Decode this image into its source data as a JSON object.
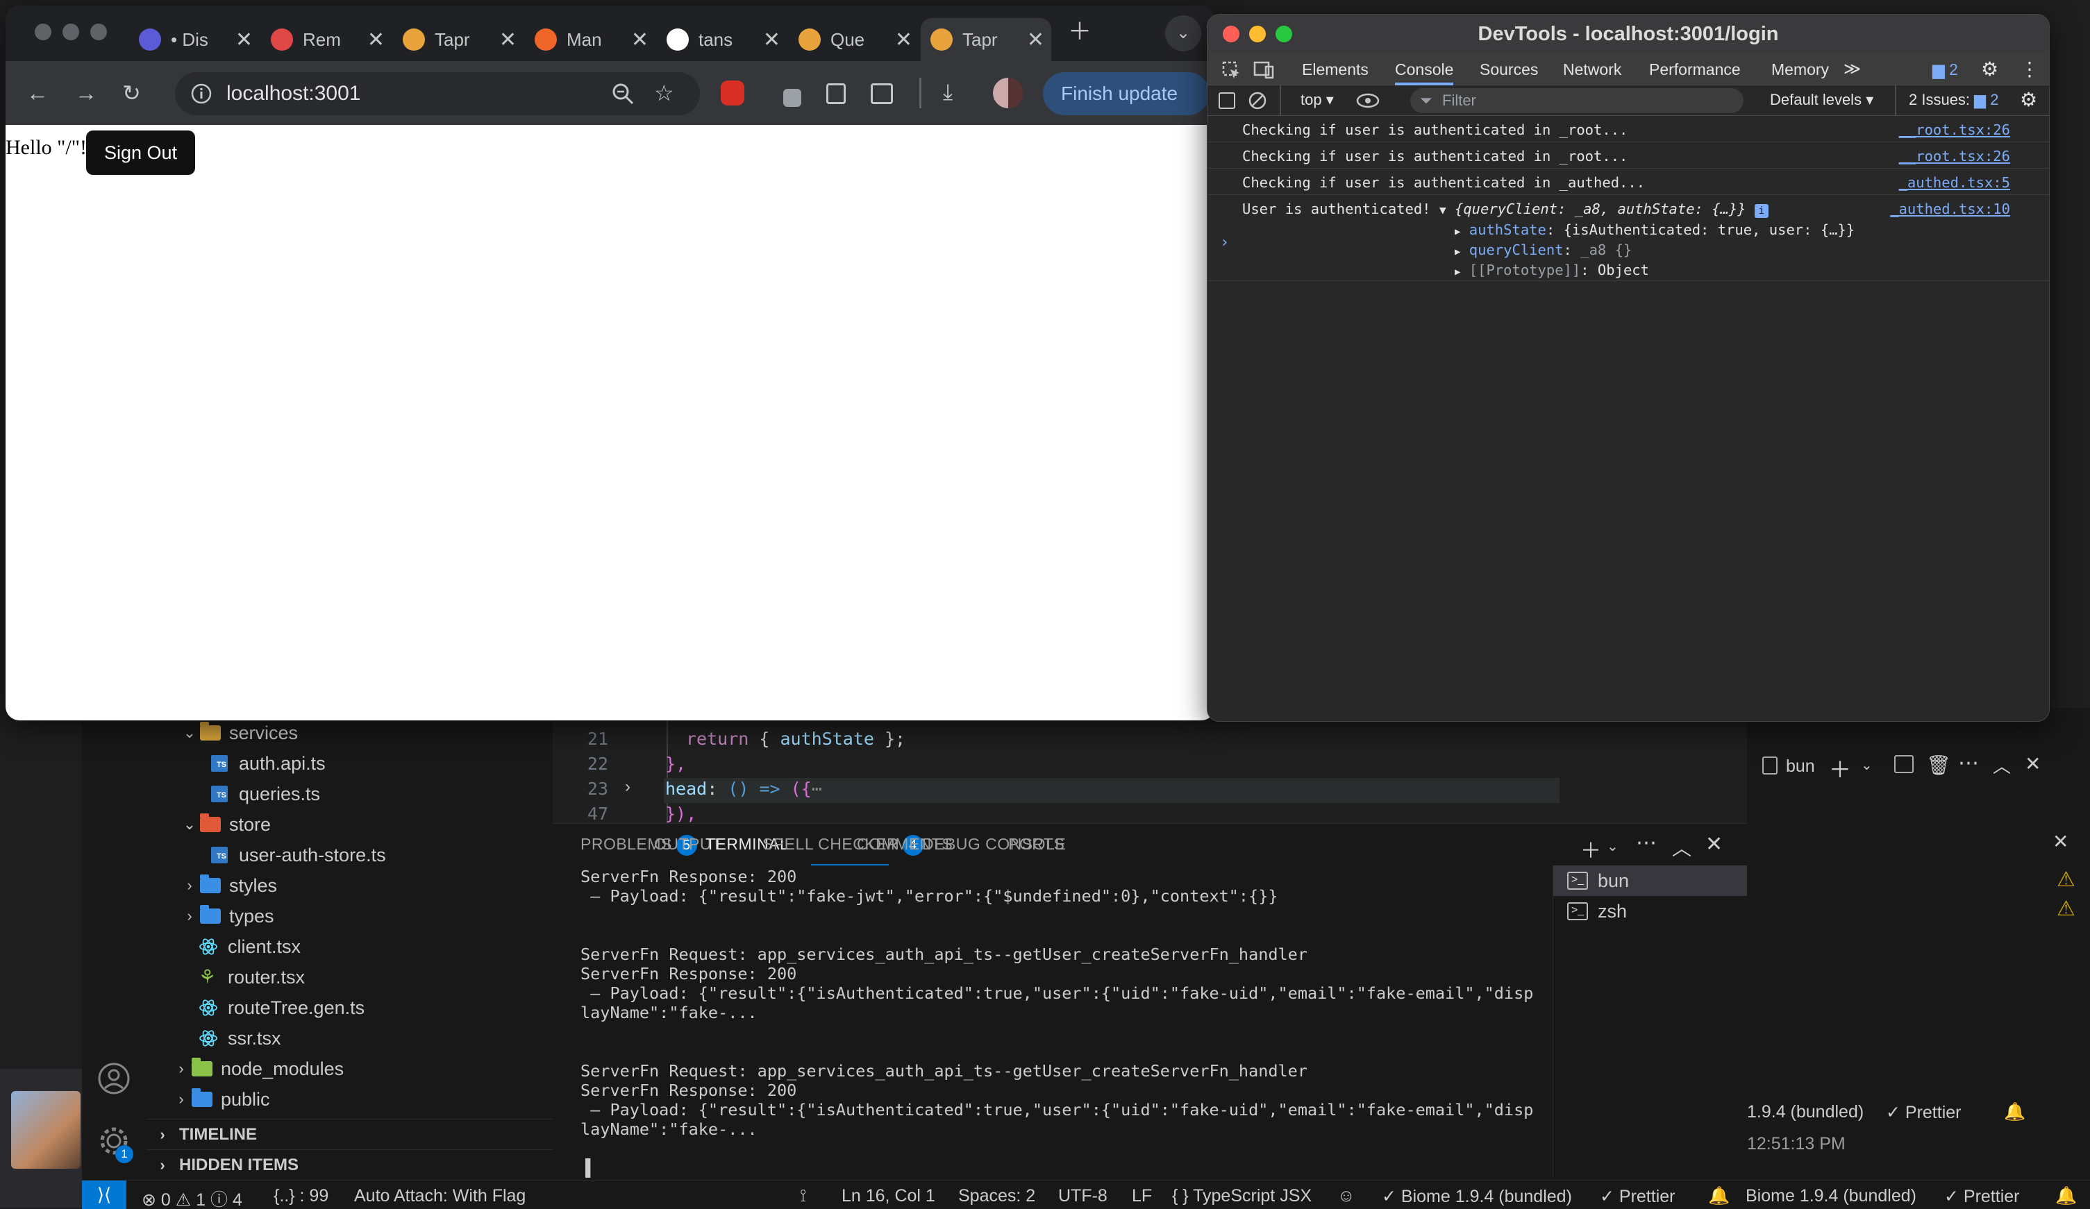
{
  "vscode": {
    "explorer": {
      "items": [
        {
          "label": "services",
          "kind": "folder",
          "open": true
        },
        {
          "label": "auth.api.ts",
          "kind": "ts"
        },
        {
          "label": "queries.ts",
          "kind": "ts"
        },
        {
          "label": "store",
          "kind": "folder",
          "open": true
        },
        {
          "label": "user-auth-store.ts",
          "kind": "ts"
        },
        {
          "label": "styles",
          "kind": "folder",
          "open": false
        },
        {
          "label": "types",
          "kind": "folder",
          "open": false
        },
        {
          "label": "client.tsx",
          "kind": "react"
        },
        {
          "label": "router.tsx",
          "kind": "router"
        },
        {
          "label": "routeTree.gen.ts",
          "kind": "react"
        },
        {
          "label": "ssr.tsx",
          "kind": "react"
        },
        {
          "label": "node_modules",
          "kind": "folder",
          "open": false
        },
        {
          "label": "public",
          "kind": "folder",
          "open": false
        }
      ],
      "sections": [
        "TIMELINE",
        "HIDDEN ITEMS"
      ]
    },
    "editor": {
      "lines": [
        {
          "num": "21",
          "code": "return { authState };"
        },
        {
          "num": "22",
          "code": "},"
        },
        {
          "num": "23",
          "code": "head: () => ({⋯"
        },
        {
          "num": "47",
          "code": "}),"
        }
      ]
    },
    "panel": {
      "tabs": [
        {
          "label": "PROBLEMS",
          "badge": "5"
        },
        {
          "label": "OUTPUT",
          "badge": ""
        },
        {
          "label": "TERMINAL",
          "badge": ""
        },
        {
          "label": "SPELL CHECKER",
          "badge": "4"
        },
        {
          "label": "COMMENTS",
          "badge": ""
        },
        {
          "label": "DEBUG CONSOLE",
          "badge": ""
        },
        {
          "label": "PORTS",
          "badge": ""
        }
      ],
      "terminal_lines": [
        "ServerFn Response: 200",
        " – Payload: {\"result\":\"fake-jwt\",\"error\":{\"$undefined\":0},\"context\":{}}",
        "",
        "",
        "ServerFn Request: app_services_auth_api_ts--getUser_createServerFn_handler",
        "ServerFn Response: 200",
        " – Payload: {\"result\":{\"isAuthenticated\":true,\"user\":{\"uid\":\"fake-uid\",\"email\":\"fake-email\",\"disp",
        "layName\":\"fake-...",
        "",
        "",
        "ServerFn Request: app_services_auth_api_ts--getUser_createServerFn_handler",
        "ServerFn Response: 200",
        " – Payload: {\"result\":{\"isAuthenticated\":true,\"user\":{\"uid\":\"fake-uid\",\"email\":\"fake-email\",\"disp",
        "layName\":\"fake-...",
        "",
        "▐"
      ],
      "terminals": [
        "bun",
        "zsh"
      ],
      "term_header": "bun"
    },
    "right_pane": {
      "biome": "1.9.4 (bundled)",
      "prettier": "Prettier",
      "time": "12:51:13 PM"
    },
    "status": {
      "errors": "0",
      "warnings": "1",
      "infos": "4",
      "json": "{..} : 99",
      "auto_attach": "Auto Attach: With Flag",
      "position": "Ln 16, Col 1",
      "spaces": "Spaces: 2",
      "encoding": "UTF-8",
      "eol": "LF",
      "language": "TypeScript JSX",
      "biome": "Biome 1.9.4 (bundled)",
      "prettier": "Prettier",
      "biome2": "Biome 1.9.4 (bundled)",
      "prettier2": "Prettier",
      "settings_badge": "1"
    }
  },
  "chrome": {
    "tabs": [
      {
        "label": "• Dis",
        "color": "#5b5bd6"
      },
      {
        "label": "Rem",
        "color": "#e04848"
      },
      {
        "label": "Tapr",
        "color": "#e8a33c"
      },
      {
        "label": "Man",
        "color": "#f0652a"
      },
      {
        "label": "tans",
        "color": "#ffffff"
      },
      {
        "label": "Que",
        "color": "#e8a33c"
      },
      {
        "label": "Tapr",
        "color": "#e8a33c"
      }
    ],
    "url": "localhost:3001",
    "finish_update": "Finish update",
    "page": {
      "hello": "Hello \"/\"!",
      "sign_out": "Sign Out"
    }
  },
  "devtools": {
    "title": "DevTools - localhost:3001/login",
    "tabs": [
      "Elements",
      "Console",
      "Sources",
      "Network",
      "Performance",
      "Memory"
    ],
    "active_tab": "Console",
    "issues_count": "2",
    "context": "top",
    "filter_placeholder": "Filter",
    "levels": "Default levels",
    "issues_label": "2 Issues:",
    "issues_badge": "2",
    "logs": [
      {
        "msg": "Checking if user is authenticated in _root...",
        "src": "__root.tsx:26"
      },
      {
        "msg": "Checking if user is authenticated in _root...",
        "src": "__root.tsx:26"
      },
      {
        "msg": "Checking if user is authenticated in _authed...",
        "src": "_authed.tsx:5"
      },
      {
        "msg": "User is authenticated!",
        "src": "_authed.tsx:10"
      }
    ],
    "object_summary": "{queryClient: _a8, authState: {…}}",
    "object_props": [
      {
        "key": "authState",
        "value": "{isAuthenticated: true, user: {…}}"
      },
      {
        "key": "queryClient",
        "value": "_a8 {}"
      },
      {
        "key": "[[Prototype]]",
        "value": "Object"
      }
    ]
  }
}
